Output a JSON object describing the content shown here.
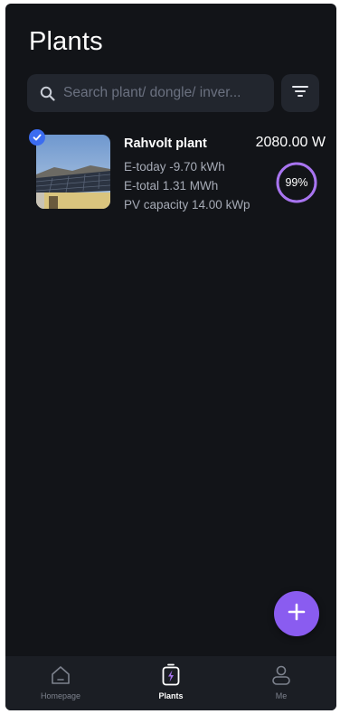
{
  "colors": {
    "background": "#121418",
    "surface": "#22262e",
    "accent": "#8a5cf0",
    "check": "#3b6cf0",
    "nav_bg": "#1b1e24"
  },
  "header": {
    "title": "Plants"
  },
  "search": {
    "placeholder": "Search plant/ dongle/ inver...",
    "value": "",
    "icon": "search-icon"
  },
  "filter": {
    "icon": "filter-icon"
  },
  "plants": [
    {
      "name": "Rahvolt plant",
      "power": "2080.00 W",
      "e_today": "E-today -9.70 kWh",
      "e_total": "E-total 1.31 MWh",
      "pv_capacity": "PV capacity 14.00 kWp",
      "percent_label": "99%",
      "percent_value": 99,
      "selected": true
    }
  ],
  "fab": {
    "icon": "plus-icon"
  },
  "nav": {
    "items": [
      {
        "label": "Homepage",
        "icon": "home-icon",
        "active": false
      },
      {
        "label": "Plants",
        "icon": "plants-icon",
        "active": true
      },
      {
        "label": "Me",
        "icon": "user-icon",
        "active": false
      }
    ]
  }
}
